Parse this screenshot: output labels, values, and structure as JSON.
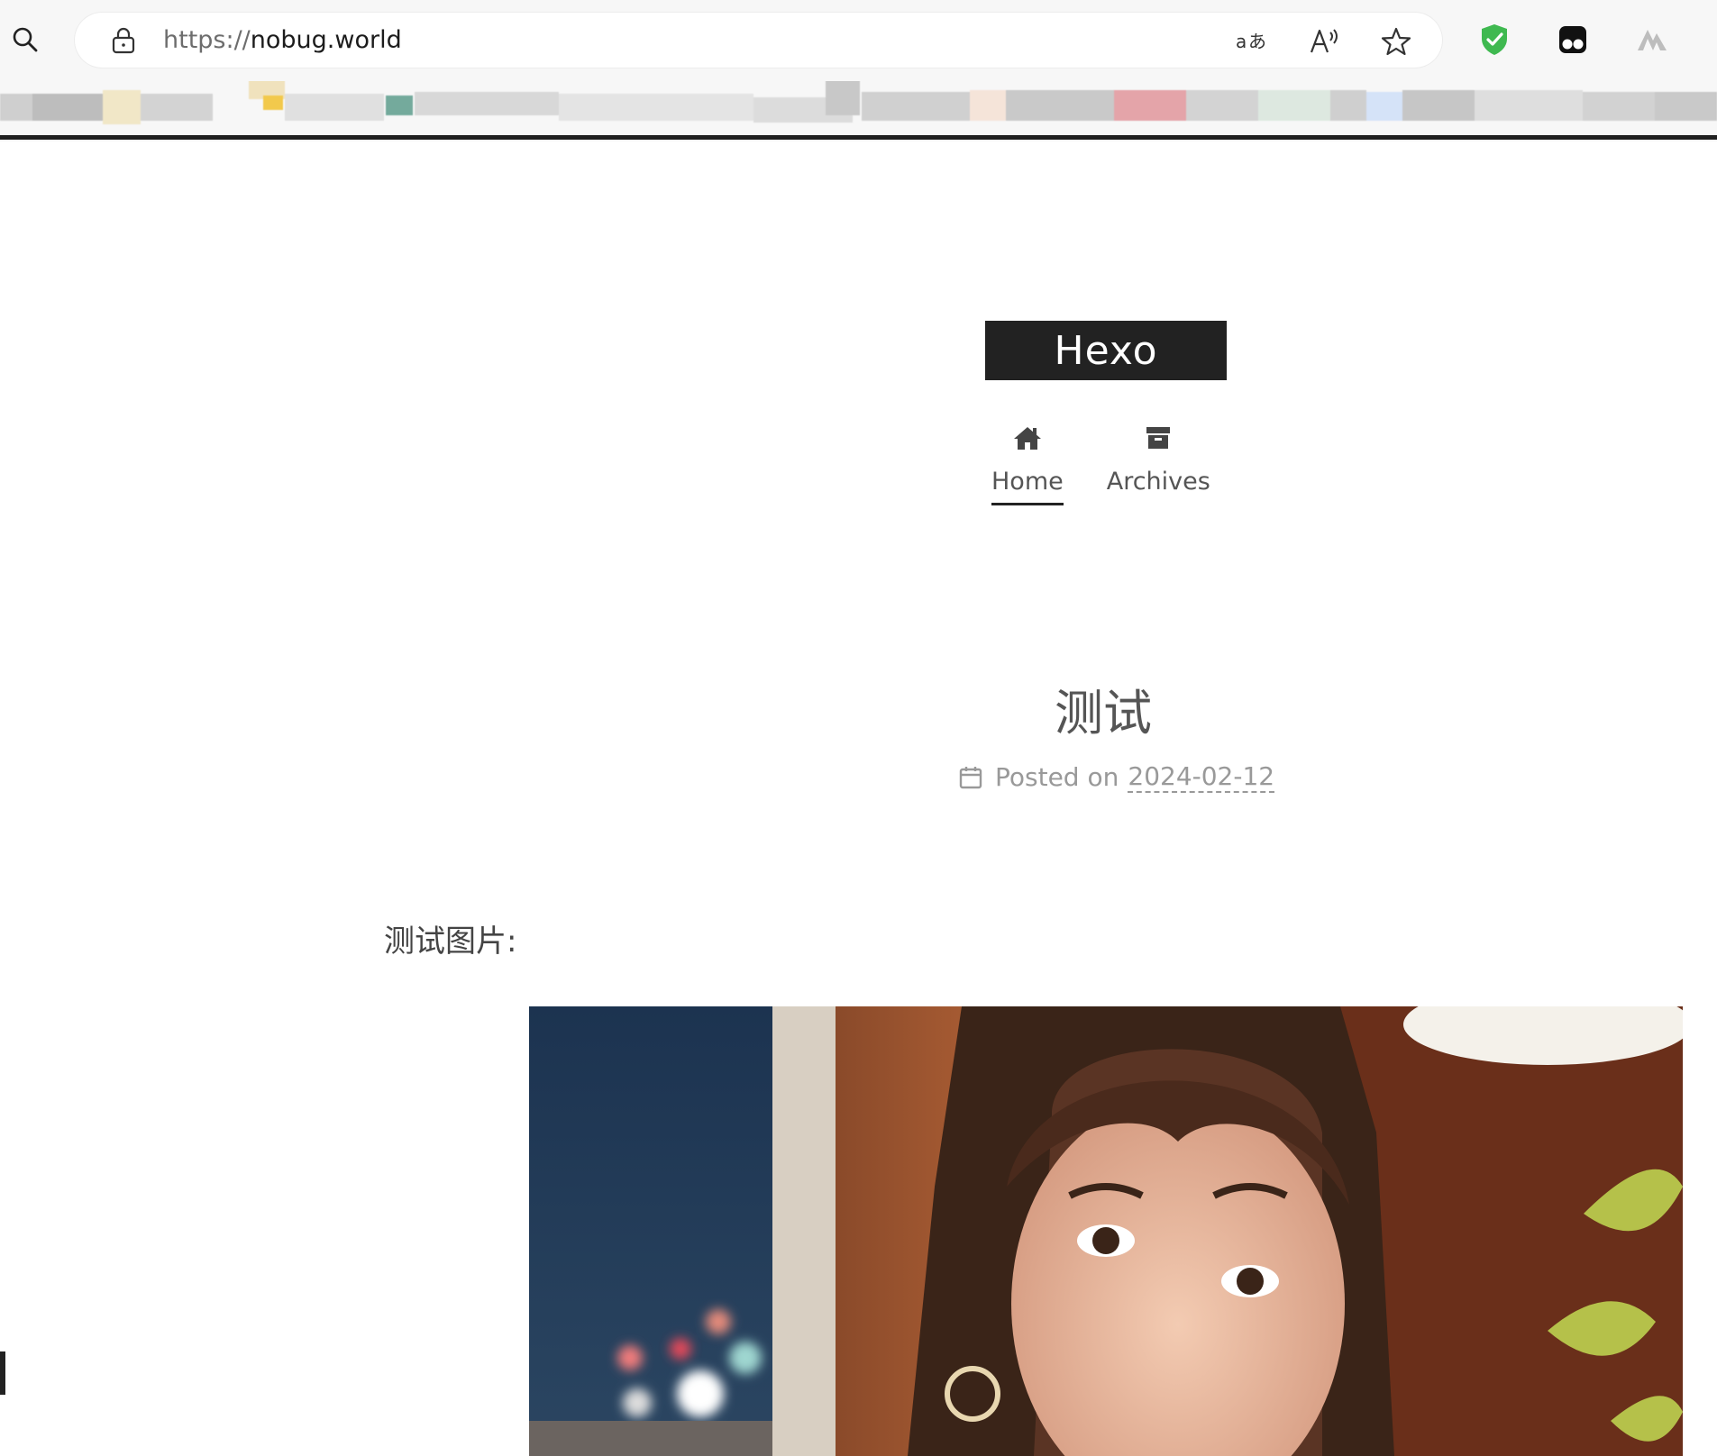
{
  "browser": {
    "url_scheme": "https://",
    "url_host": "nobug.world",
    "icons": {
      "search": "search-icon",
      "lock": "lock-icon",
      "translate": "translate-icon",
      "read_aloud": "read-aloud-icon",
      "favorite": "star-icon",
      "extensions": [
        "shield-check-icon",
        "incognito-glasses-icon",
        "mountain-logo-icon"
      ]
    }
  },
  "site": {
    "title": "Hexo",
    "menu": [
      {
        "label": "Home",
        "icon": "home-icon",
        "active": true
      },
      {
        "label": "Archives",
        "icon": "archive-icon",
        "active": false
      }
    ]
  },
  "post": {
    "title": "测试",
    "meta_prefix": "Posted on",
    "date": "2024-02-12",
    "body_text": "测试图片:"
  },
  "colors": {
    "brand_bg": "#222222",
    "text_primary": "#555555",
    "text_muted": "#999999",
    "shield_green": "#3fb950"
  }
}
